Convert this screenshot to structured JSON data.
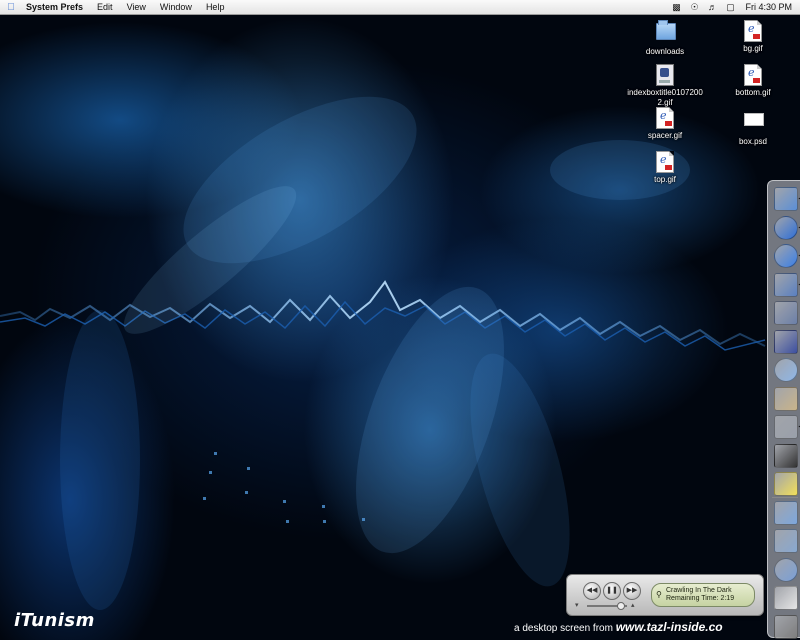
{
  "menubar": {
    "apple_icon": "apple-logo",
    "app_name": "System Prefs",
    "menus": [
      "Edit",
      "View",
      "Window",
      "Help"
    ],
    "extras": [
      "screen-icon",
      "wifi-icon",
      "volume-icon",
      "display-icon"
    ],
    "clock": "Fri 4:30 PM"
  },
  "desktop_icons": [
    {
      "label": "downloads",
      "icon": "folder-icon"
    },
    {
      "label": "bg.gif",
      "icon": "gif-document-icon"
    },
    {
      "label": "indexboxtitle0107200\n2.gif",
      "icon": "app-document-icon"
    },
    {
      "label": "bottom.gif",
      "icon": "gif-document-icon"
    },
    {
      "label": "spacer.gif",
      "icon": "gif-document-icon"
    },
    {
      "label": "box.psd",
      "icon": "psd-document-icon"
    },
    {
      "label": "top.gif",
      "icon": "gif-document-icon"
    }
  ],
  "dock": {
    "items": [
      {
        "name": "finder-icon",
        "color": "#5b8fd6"
      },
      {
        "name": "internet-explorer-icon",
        "color": "#2e6fd8"
      },
      {
        "name": "globe-icon",
        "color": "#3b7fe6"
      },
      {
        "name": "ichat-icon",
        "color": "#5a80c0"
      },
      {
        "name": "mail-icon",
        "color": "#6b7fa8"
      },
      {
        "name": "bbedit-icon",
        "color": "#3c4fa0"
      },
      {
        "name": "itunes-icon",
        "color": "#8fb7e8"
      },
      {
        "name": "address-book-icon",
        "color": "#c9b48a"
      },
      {
        "name": "system-preferences-icon",
        "color": "#9aa0aa"
      },
      {
        "name": "terminal-icon",
        "color": "#333333"
      },
      {
        "name": "stickies-icon",
        "color": "#f2df5a"
      },
      {
        "name": "applications-folder-icon",
        "color": "#7da7dd"
      },
      {
        "name": "documents-folder-icon",
        "color": "#88a8d0"
      },
      {
        "name": "mac-os-x-icon",
        "color": "#7aa0d8"
      },
      {
        "name": "document-stack-icon",
        "color": "#e6e6e6"
      },
      {
        "name": "trash-icon",
        "color": "#7d7d7d"
      }
    ]
  },
  "itunes": {
    "track": "Crawling In The Dark",
    "remaining": "Remaining Time: 2:19",
    "volume_level": 0.85
  },
  "footer": {
    "logo": "iTunism",
    "credit_prefix": "a desktop screen from",
    "credit_site": "www.tazl-inside.co"
  }
}
